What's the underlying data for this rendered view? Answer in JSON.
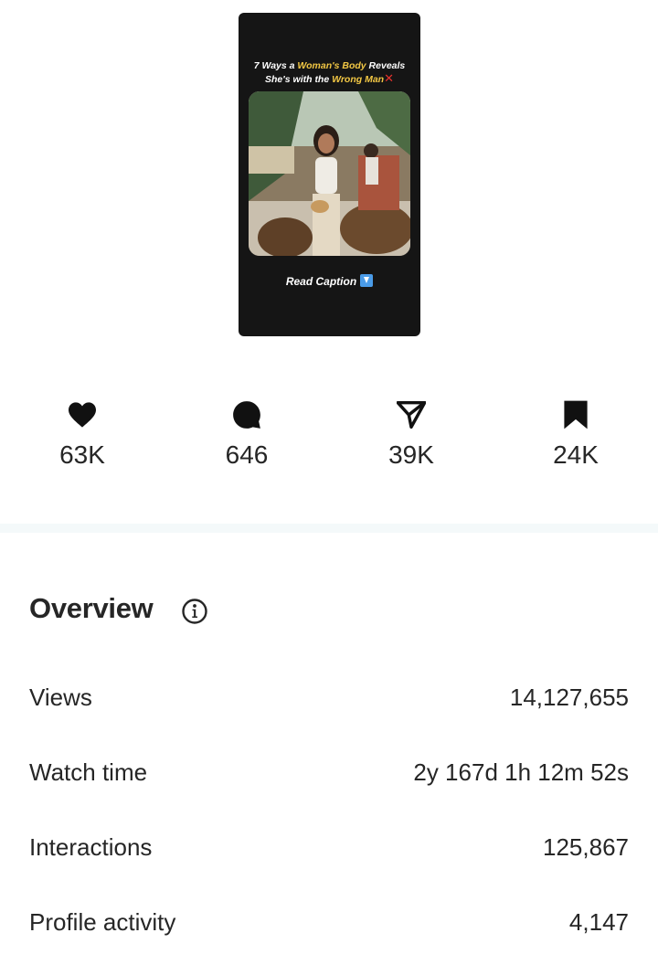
{
  "thumbnail": {
    "title_line1_a": "7 Ways a ",
    "title_line1_hl": "Woman's Body",
    "title_line1_b": " Reveals",
    "title_line2_a": "She's with the ",
    "title_line2_hl": "Wrong Man",
    "cta": "Read Caption",
    "highlight_color": "#f2c744"
  },
  "stats": [
    {
      "icon": "heart-icon",
      "value": "63K"
    },
    {
      "icon": "comment-icon",
      "value": "646"
    },
    {
      "icon": "share-icon",
      "value": "39K"
    },
    {
      "icon": "bookmark-icon",
      "value": "24K"
    }
  ],
  "overview": {
    "title": "Overview",
    "rows": [
      {
        "label": "Views",
        "value": "14,127,655"
      },
      {
        "label": "Watch time",
        "value": "2y 167d 1h 12m 52s"
      },
      {
        "label": "Interactions",
        "value": "125,867"
      },
      {
        "label": "Profile activity",
        "value": "4,147"
      }
    ]
  }
}
